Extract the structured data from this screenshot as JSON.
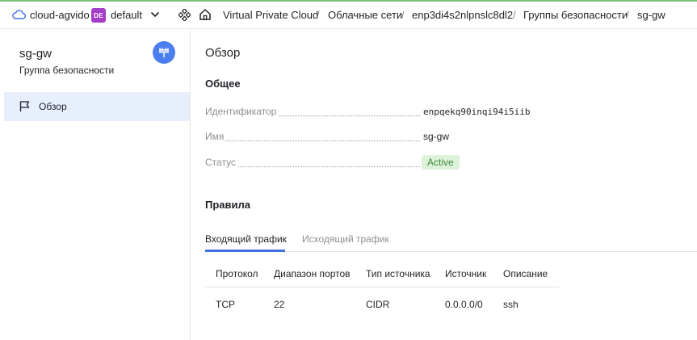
{
  "header": {
    "cloud_name": "cloud-agvido",
    "folder_badge": "DE",
    "folder_name": "default",
    "breadcrumbs": [
      "Virtual Private Cloud",
      "Облачные сети",
      "enp3di4s2nlpnslc8dl2",
      "Группы безопасности",
      "sg-gw"
    ],
    "separator": "/"
  },
  "sidebar": {
    "title": "sg-gw",
    "subtitle": "Группа безопасности",
    "items": [
      {
        "label": "Обзор",
        "icon": "flag-icon",
        "active": true
      }
    ]
  },
  "main": {
    "page_title": "Обзор",
    "general": {
      "heading": "Общее",
      "properties": [
        {
          "key": "Идентификатор",
          "value": "enpqekq90inqi94i5iib"
        },
        {
          "key": "Имя",
          "value": "sg-gw"
        },
        {
          "key": "Статус",
          "value": "Active"
        }
      ]
    },
    "rules": {
      "heading": "Правила",
      "tabs": [
        {
          "label": "Входящий трафик",
          "active": true
        },
        {
          "label": "Исходящий трафик",
          "active": false
        }
      ],
      "columns": [
        "Протокол",
        "Диапазон портов",
        "Тип источника",
        "Источник",
        "Описание"
      ],
      "rows": [
        [
          "TCP",
          "22",
          "CIDR",
          "0.0.0.0/0",
          "ssh"
        ]
      ]
    }
  },
  "colors": {
    "accent": "#3f6fe0",
    "folder_badge": "#a43ec8",
    "active_bg": "#def2da",
    "active_text": "#3b8a3e",
    "sidebar_selected": "#e7eefc"
  }
}
